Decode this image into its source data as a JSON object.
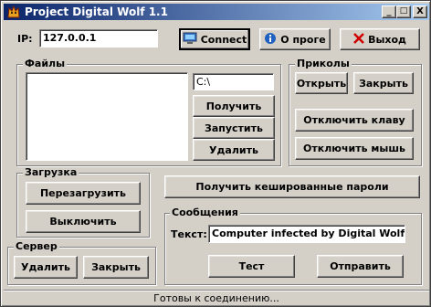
{
  "window": {
    "title": "Project Digital Wolf 1.1",
    "controls": {
      "minimize": "_",
      "maximize": "□",
      "close": "X"
    }
  },
  "connection": {
    "ip_label": "IP:",
    "ip_value": "127.0.0.1",
    "connect_label": "Connect",
    "about_label": "О проге",
    "exit_label": "Выход"
  },
  "files": {
    "group_title": "Файлы",
    "path_value": "C:\\",
    "get_label": "Получить",
    "run_label": "Запустить",
    "delete_label": "Удалить"
  },
  "pranks": {
    "group_title": "Приколы",
    "open_label": "Открыть",
    "close_label": "Закрыть",
    "disable_keyboard_label": "Отключить клаву",
    "disable_mouse_label": "Отключить мышь"
  },
  "boot": {
    "group_title": "Загрузка",
    "reboot_label": "Перезагрузить",
    "shutdown_label": "Выключить"
  },
  "server": {
    "group_title": "Сервер",
    "delete_label": "Удалить",
    "close_label": "Закрыть"
  },
  "passwords": {
    "get_cached_label": "Получить кешированные пароли"
  },
  "messages": {
    "group_title": "Сообщения",
    "text_label": "Текст:",
    "text_value": "Computer infected by Digital Wolf!",
    "test_label": "Тест",
    "send_label": "Отправить"
  },
  "status": {
    "text": "Готовы к соединению..."
  },
  "colors": {
    "face": "#d4d0c8",
    "title_start": "#0a246a",
    "title_end": "#a6caf0"
  },
  "icons": {
    "app": "wolf-app-icon",
    "connect": "monitor-icon",
    "about": "info-icon",
    "exit": "red-x-icon"
  }
}
